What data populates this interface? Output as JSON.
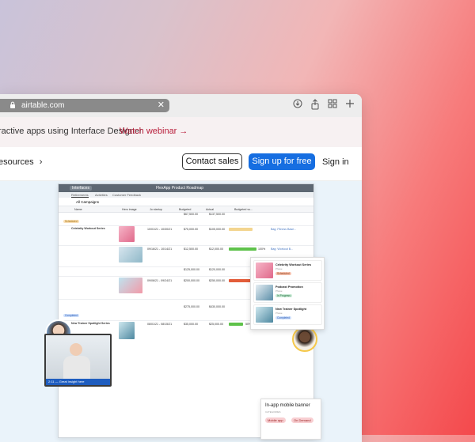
{
  "browser": {
    "url": "airtable.com",
    "clear_icon": "close-icon",
    "toolbar_icons": [
      "download-icon",
      "share-icon",
      "tabs-overview-icon",
      "new-tab-icon"
    ]
  },
  "announcement": {
    "text": "ractive apps using Interface Designer",
    "link": "Watch webinar →"
  },
  "nav": {
    "resources": "esources",
    "resources_chevron": "›",
    "contact_sales": "Contact sales",
    "sign_up": "Sign up for free",
    "sign_in": "Sign in"
  },
  "colors": {
    "accent": "#166ee1",
    "announce_link": "#b81d3a",
    "bg_gradient_start": "#c9c3da",
    "bg_gradient_end": "#f4494c"
  },
  "app": {
    "interface_label": "Interfaces",
    "title": "FlexApp Product Roadmap",
    "tabs": [
      "Retirements",
      "Activities",
      "Customer Feedback"
    ],
    "view": "All Campaigns",
    "columns": [
      "Name",
      "Hero image",
      "Jo startup",
      "Budgeted",
      "Actual",
      "Budgeted vs..."
    ],
    "groups": [
      "Scheduled",
      "Completed"
    ],
    "rows": [
      {
        "name": "Celebrity Workout Series",
        "dates": "10/01/21 - 10/30/21",
        "budgeted": "$75,000.00",
        "actual": "$105,000.00"
      },
      {
        "name": "",
        "dates": "09/16/21 - 10/14/21",
        "budgeted": "$12,500.00",
        "actual": "$12,000.00",
        "pct": "100%"
      },
      {
        "name": "",
        "dates": "09/06/21 - 09/24/21",
        "budgeted": "$200,000.00",
        "actual": "$250,000.00",
        "pct": "200%",
        "note": "Media for promotion"
      },
      {
        "name": "New Trainer Spotlight Series",
        "dates": "08/01/21 - 08/15/21",
        "budgeted": "$35,000.00",
        "actual": "$25,000.00",
        "pct": "50%"
      }
    ],
    "subtotals": [
      {
        "budgeted": "$67,500.00",
        "actual": "$137,500.00"
      },
      {
        "budgeted": "$125,000.00",
        "actual": "$120,000.00"
      },
      {
        "budgeted": "$275,000.00",
        "actual": "$430,000.00"
      }
    ],
    "links": [
      "Bag: Fitness Base...",
      "Bag: Workout B..."
    ]
  },
  "video": {
    "caption": "2:11 — Great insight here"
  },
  "kanban": {
    "cards": [
      {
        "title": "Celebrity Workout Series",
        "sub": "Phase",
        "status": "Scheduled",
        "color": "#f7c3b0"
      },
      {
        "title": "Podcast Promotion",
        "sub": "Phase",
        "status": "In Progress",
        "color": "#c8ead5"
      },
      {
        "title": "New Trainer Spotlight",
        "sub": "Phase",
        "status": "Completed",
        "color": "#cfe0fb"
      }
    ]
  },
  "popup": {
    "title": "In-app mobile banner",
    "sub": "CATEGORIES",
    "tags": [
      "Mobile app",
      "On Demand"
    ]
  }
}
